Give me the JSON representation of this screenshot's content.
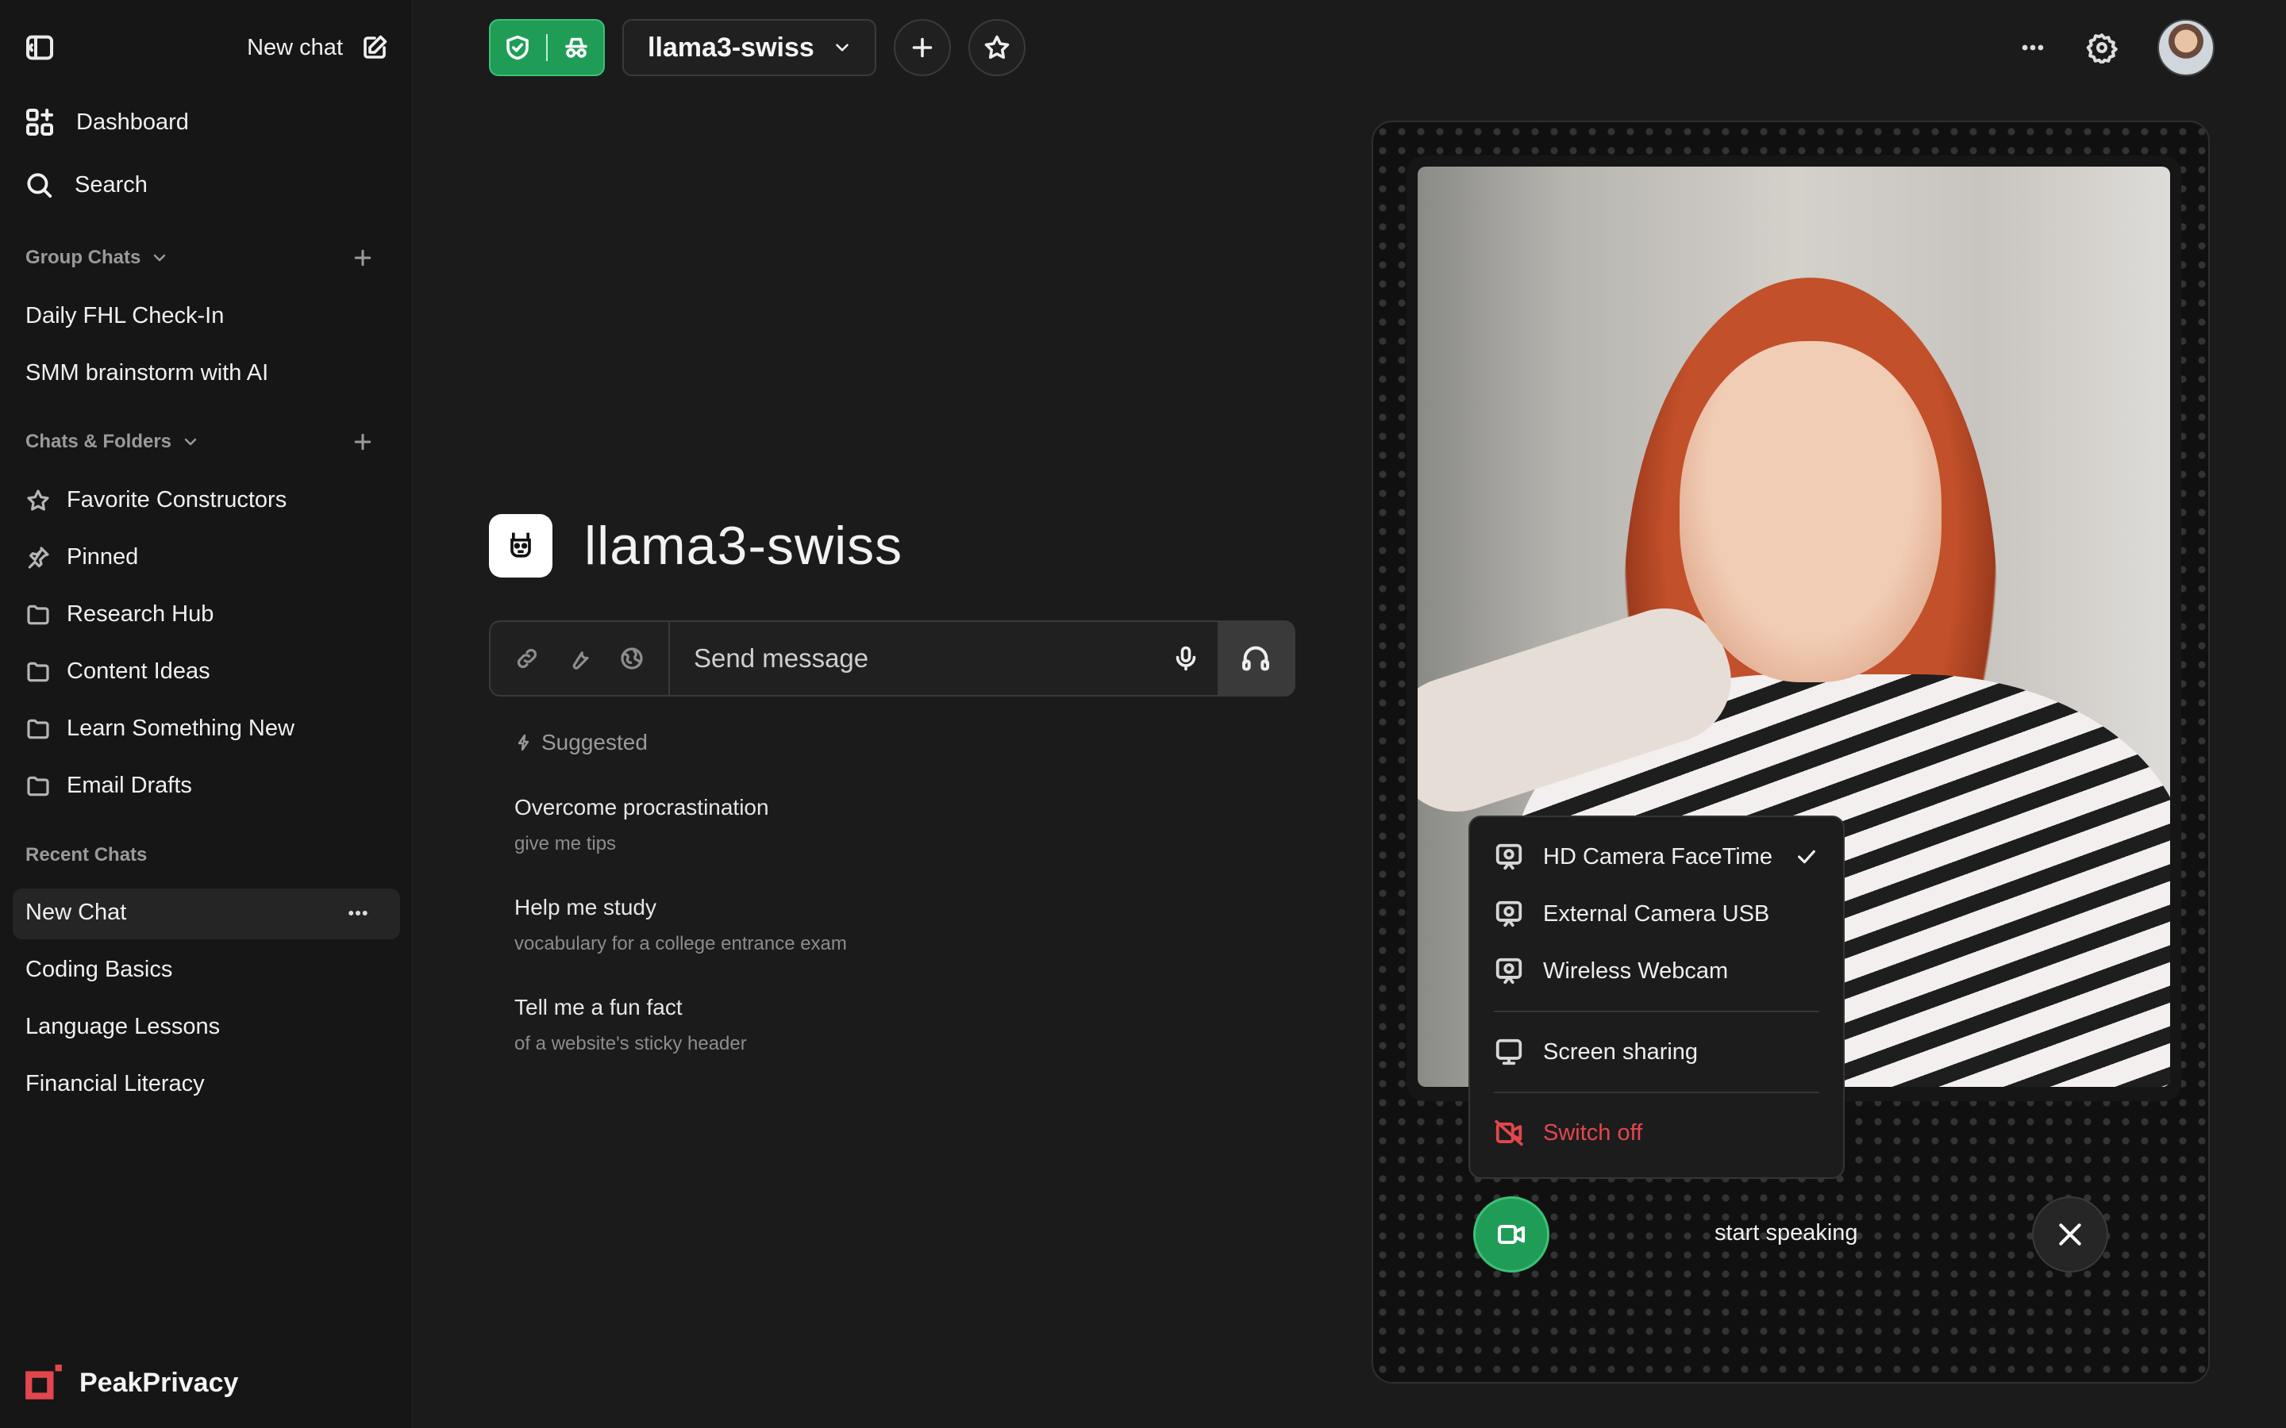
{
  "sidebar": {
    "new_chat": "New chat",
    "nav": [
      {
        "label": "Dashboard",
        "icon": "dashboard-icon"
      },
      {
        "label": "Search",
        "icon": "search-icon"
      }
    ],
    "group_chats": {
      "title": "Group Chats",
      "items": [
        "Daily FHL Check-In",
        "SMM brainstorm with AI"
      ]
    },
    "chats_folders": {
      "title": "Chats & Folders",
      "items": [
        {
          "label": "Favorite Constructors",
          "icon": "star-icon"
        },
        {
          "label": "Pinned",
          "icon": "pin-icon"
        },
        {
          "label": "Research Hub",
          "icon": "folder-icon"
        },
        {
          "label": "Content Ideas",
          "icon": "folder-icon"
        },
        {
          "label": "Learn Something New",
          "icon": "folder-icon"
        },
        {
          "label": "Email Drafts",
          "icon": "folder-icon"
        }
      ]
    },
    "recent": {
      "title": "Recent Chats",
      "items": [
        "New Chat",
        "Coding Basics",
        "Language Lessons",
        "Financial Literacy"
      ]
    },
    "brand": "PeakPrivacy"
  },
  "topbar": {
    "model": "llama3-swiss"
  },
  "main": {
    "title": "llama3-swiss",
    "placeholder": "Send message",
    "suggested_label": "Suggested",
    "suggestions": [
      {
        "title": "Overcome procrastination",
        "sub": "give me tips"
      },
      {
        "title": "Help me study",
        "sub": "vocabulary for a college entrance exam"
      },
      {
        "title": "Tell me a fun fact",
        "sub": "of a website's sticky header"
      }
    ]
  },
  "video": {
    "menu": [
      {
        "label": "HD Camera FaceTime",
        "selected": true
      },
      {
        "label": "External Camera USB",
        "selected": false
      },
      {
        "label": "Wireless Webcam",
        "selected": false
      }
    ],
    "screen_sharing": "Screen sharing",
    "switch_off": "Switch off",
    "status": "start speaking"
  },
  "colors": {
    "accent": "#1f9d57",
    "danger": "#e2474d",
    "background": "#1b1b1b"
  }
}
